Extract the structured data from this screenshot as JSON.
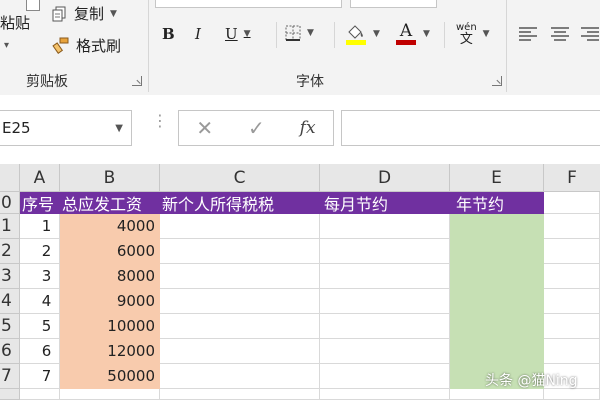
{
  "ribbon": {
    "clipboard": {
      "paste_label": "粘贴",
      "copy_label": "复制",
      "format_painter_label": "格式刷",
      "group_label": "剪贴板"
    },
    "font": {
      "bold_label": "B",
      "italic_label": "I",
      "underline_label": "U",
      "font_color_letter": "A",
      "wen_top": "wén",
      "wen_bottom": "文",
      "group_label": "字体",
      "fill_color": "#ffff00",
      "font_color": "#c00000"
    }
  },
  "formula_bar": {
    "name_box": "E25",
    "fx_label": "fx"
  },
  "grid": {
    "columns": [
      "A",
      "B",
      "C",
      "D",
      "E",
      "F"
    ],
    "row_numbers": [
      "0",
      "1",
      "2",
      "3",
      "4",
      "5",
      "6",
      "7"
    ],
    "header_row": [
      "序号",
      "总应发工资",
      "新个人所得税税",
      "每月节约",
      "年节约"
    ],
    "rows": [
      {
        "no": "1",
        "salary": "4000"
      },
      {
        "no": "2",
        "salary": "6000"
      },
      {
        "no": "3",
        "salary": "8000"
      },
      {
        "no": "4",
        "salary": "9000"
      },
      {
        "no": "5",
        "salary": "10000"
      },
      {
        "no": "6",
        "salary": "12000"
      },
      {
        "no": "7",
        "salary": "50000"
      }
    ]
  },
  "colors": {
    "header_purple": "#7030a0",
    "salary_orange": "#f8cbad",
    "year_green": "#c6e0b4"
  },
  "watermark": "头条 @猫Ning"
}
